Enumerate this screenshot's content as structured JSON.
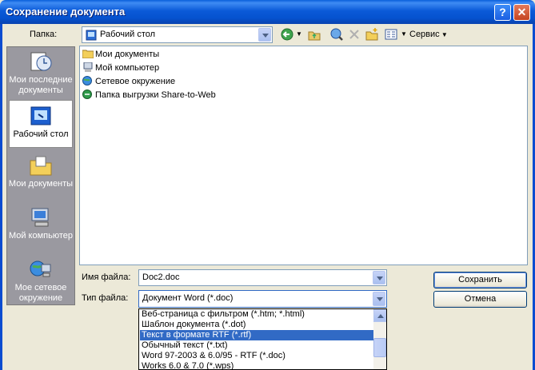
{
  "window": {
    "title": "Сохранение документа",
    "help_label": "?",
    "close_label": "✕"
  },
  "toolbar": {
    "folder_label": "Папка:",
    "folder_value": "Рабочий стол",
    "tools_label": "Сервис"
  },
  "places": [
    {
      "label": "Мои последние документы",
      "icon": "recent-documents-icon"
    },
    {
      "label": "Рабочий стол",
      "icon": "desktop-icon",
      "selected": true
    },
    {
      "label": "Мои документы",
      "icon": "my-documents-folder-icon"
    },
    {
      "label": "Мой компьютер",
      "icon": "my-computer-icon"
    },
    {
      "label": "Мое сетевое окружение",
      "icon": "network-places-icon"
    }
  ],
  "files": [
    {
      "name": "Мои документы",
      "icon": "folder-icon"
    },
    {
      "name": "Мой компьютер",
      "icon": "computer-icon"
    },
    {
      "name": "Сетевое окружение",
      "icon": "network-icon"
    },
    {
      "name": "Папка выгрузки Share-to-Web",
      "icon": "web-folder-icon"
    }
  ],
  "form": {
    "filename_label": "Имя файла:",
    "filename_value": "Doc2.doc",
    "filetype_label": "Тип файла:",
    "filetype_value": "Документ Word (*.doc)"
  },
  "buttons": {
    "save": "Сохранить",
    "cancel": "Отмена"
  },
  "filetype_options": [
    "Веб-страница с фильтром (*.htm; *.html)",
    "Шаблон документа (*.dot)",
    "Текст в формате RTF (*.rtf)",
    "Обычный текст (*.txt)",
    "Word 97-2003 & 6.0/95 - RTF (*.doc)",
    "Works 6.0 & 7.0 (*.wps)"
  ],
  "selected_option_index": 2,
  "colors": {
    "title_bar": "#0a5fdb",
    "selection": "#316ac5",
    "places_bar": "#9a99a0"
  }
}
